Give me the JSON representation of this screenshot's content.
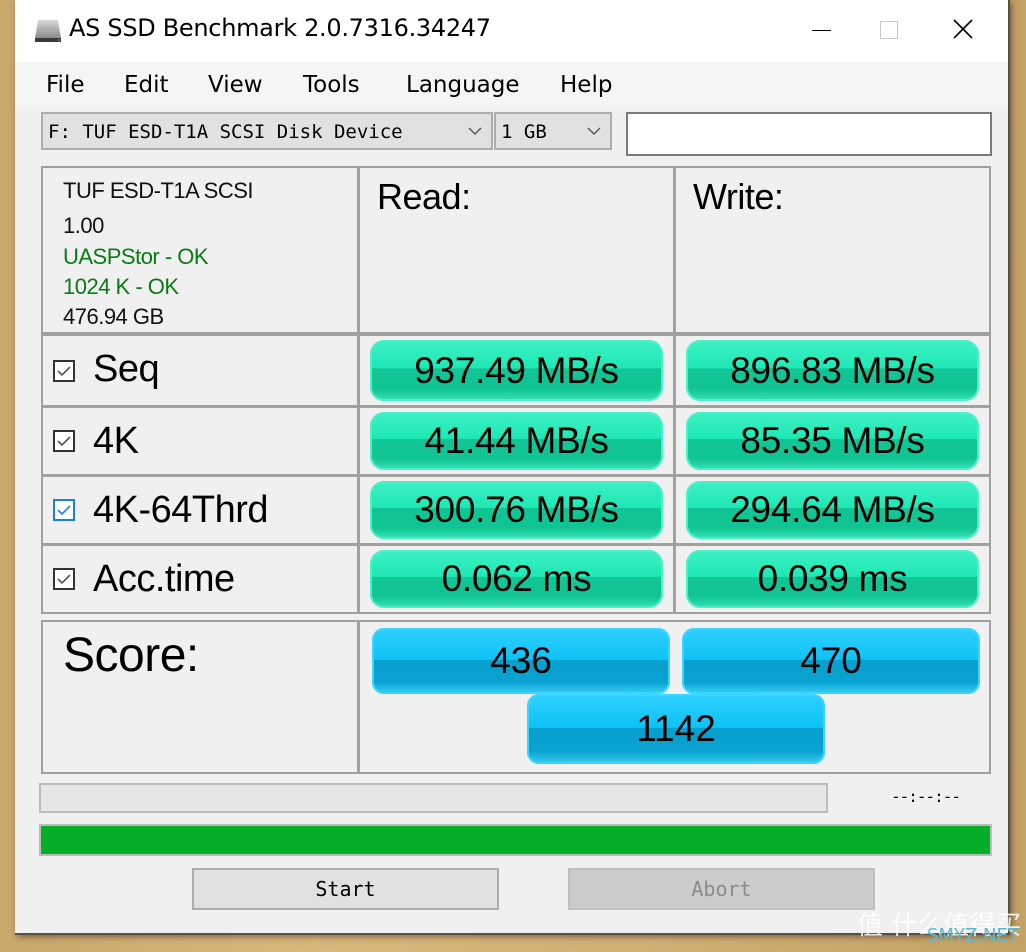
{
  "window": {
    "title": "AS SSD Benchmark 2.0.7316.34247",
    "app_icon": "ssd-drive-icon",
    "controls": {
      "minimize": "minimize-icon",
      "maximize": "maximize-icon",
      "close": "close-icon"
    }
  },
  "menu": [
    "File",
    "Edit",
    "View",
    "Tools",
    "Language",
    "Help"
  ],
  "toolbar": {
    "drive_select": "F: TUF ESD-T1A SCSI Disk Device",
    "size_select": "1 GB",
    "text_field": ""
  },
  "device_info": {
    "name": "TUF ESD-T1A SCSI",
    "firmware": "1.00",
    "driver_status": "UASPStor - OK",
    "alignment_status": "1024 K - OK",
    "capacity": "476.94 GB"
  },
  "headers": {
    "read": "Read:",
    "write": "Write:"
  },
  "tests": [
    {
      "name": "Seq",
      "checked": true,
      "read": "937.49 MB/s",
      "write": "896.83 MB/s"
    },
    {
      "name": "4K",
      "checked": true,
      "read": "41.44 MB/s",
      "write": "85.35 MB/s"
    },
    {
      "name": "4K-64Thrd",
      "checked": true,
      "focused": true,
      "read": "300.76 MB/s",
      "write": "294.64 MB/s"
    },
    {
      "name": "Acc.time",
      "checked": true,
      "read": "0.062 ms",
      "write": "0.039 ms"
    }
  ],
  "score": {
    "label": "Score:",
    "read": "436",
    "write": "470",
    "total": "1142"
  },
  "status": {
    "time_readout": "--:--:--",
    "test_progress_percent": 0,
    "overall_progress_percent": 100
  },
  "buttons": {
    "start": "Start",
    "abort": "Abort"
  },
  "colors": {
    "result_green": "#1ee8b5",
    "score_blue": "#0dc3f5",
    "progress_green": "#05af28",
    "status_ok_green": "#0a7a14"
  },
  "watermark": {
    "text": "值 什么值得买",
    "sub": "SMYZ.NET"
  }
}
